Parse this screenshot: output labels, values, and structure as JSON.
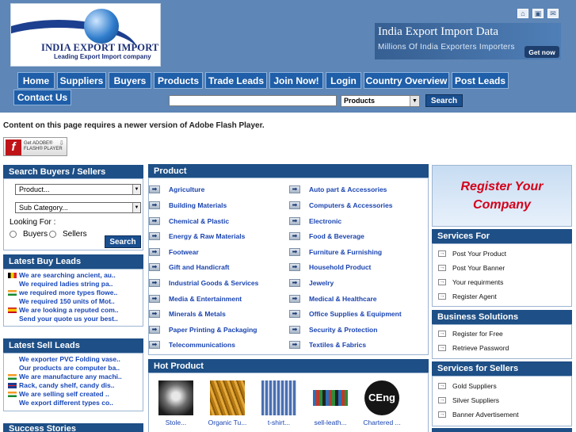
{
  "header": {
    "logo_title": "INDIA EXPORT IMPORT",
    "logo_tagline": "Leading Export Import company",
    "icons": [
      "home-icon",
      "save-icon",
      "mail-icon"
    ],
    "banner_title": "India Export Import Data",
    "banner_sub": "Millions Of India Exporters Importers",
    "banner_button": "Get now"
  },
  "nav": {
    "items": [
      "Home",
      "Suppliers",
      "Buyers",
      "Products",
      "Trade Leads",
      "Join Now!",
      "Login",
      "Country Overview",
      "Post Leads"
    ],
    "contact": "Contact Us",
    "search_value": "",
    "search_category": "Products",
    "search_button": "Search"
  },
  "flash": {
    "message": "Content on this page requires a newer version of Adobe Flash Player.",
    "badge_line1": "Get ADOBE®",
    "badge_line2": "FLASH® PLAYER"
  },
  "search_panel": {
    "title": "Search Buyers / Sellers",
    "product_select": "Product...",
    "subcat_select": "Sub Category...",
    "looking_for": "Looking For :",
    "opt_buyers": "Buyers",
    "opt_sellers": "Sellers",
    "button": "Search"
  },
  "buy_leads": {
    "title": "Latest Buy Leads",
    "items": [
      {
        "flag": "be",
        "text": "We are searching ancient, au.."
      },
      {
        "flag": "none",
        "text": "We required ladies string pa.."
      },
      {
        "flag": "in",
        "text": "we required more types flowe.."
      },
      {
        "flag": "none",
        "text": "We required 150 units of Mot.."
      },
      {
        "flag": "es",
        "text": "We are looking a reputed com.."
      },
      {
        "flag": "none",
        "text": "Send your quote us your best.."
      }
    ]
  },
  "sell_leads": {
    "title": "Latest Sell Leads",
    "items": [
      {
        "flag": "none",
        "text": "We exporter PVC Folding vase.."
      },
      {
        "flag": "none",
        "text": "Our products are computer ba.."
      },
      {
        "flag": "in",
        "text": "We are manufacture any machi.."
      },
      {
        "flag": "gb",
        "text": "Rack, candy shelf, candy dis.."
      },
      {
        "flag": "in",
        "text": "We are selling self created .."
      },
      {
        "flag": "none",
        "text": "We export different types co.."
      }
    ]
  },
  "success_title": "Success Stories",
  "products": {
    "title": "Product",
    "left": [
      "Agriculture",
      "Building Materials",
      "Chemical & Plastic",
      "Energy & Raw Materials",
      "Footwear",
      "Gift and Handicraft",
      "Industrial Goods & Services",
      "Media & Entertainment",
      "Minerals & Metals",
      "Paper Printing & Packaging",
      "Telecommunications"
    ],
    "right": [
      "Auto part & Accessories",
      "Computers & Accessories",
      "Electronic",
      "Food & Beverage",
      "Furniture & Furnishing",
      "Household Product",
      "Jewelry",
      "Medical & Healthcare",
      "Office Supplies & Equipment",
      "Security & Protection",
      "Textiles & Fabrics"
    ]
  },
  "hot_products": {
    "title": "Hot Product",
    "items": [
      "Stole...",
      "Organic Tu...",
      "t-shirt...",
      "sell-leath...",
      "Chartered ..."
    ],
    "logo_text": "CEng"
  },
  "right": {
    "register_line1": "Register Your",
    "register_line2": "Company",
    "services_for": {
      "title": "Services For",
      "items": [
        "Post Your Product",
        "Post Your Banner",
        "Your requirments",
        "Register Agent"
      ]
    },
    "business": {
      "title": "Business Solutions",
      "items": [
        "Register for Free",
        "Retrieve Password"
      ]
    },
    "sellers": {
      "title": "Services for Sellers",
      "items": [
        "Gold Suppliers",
        "Silver Suppliers",
        "Banner Advertisement"
      ]
    }
  },
  "colors": {
    "header_bg": "#5e86b6",
    "nav_bg": "#1f5ea8",
    "panel_head": "#1e4f86",
    "link": "#1a44b0",
    "register": "#d4001a"
  }
}
